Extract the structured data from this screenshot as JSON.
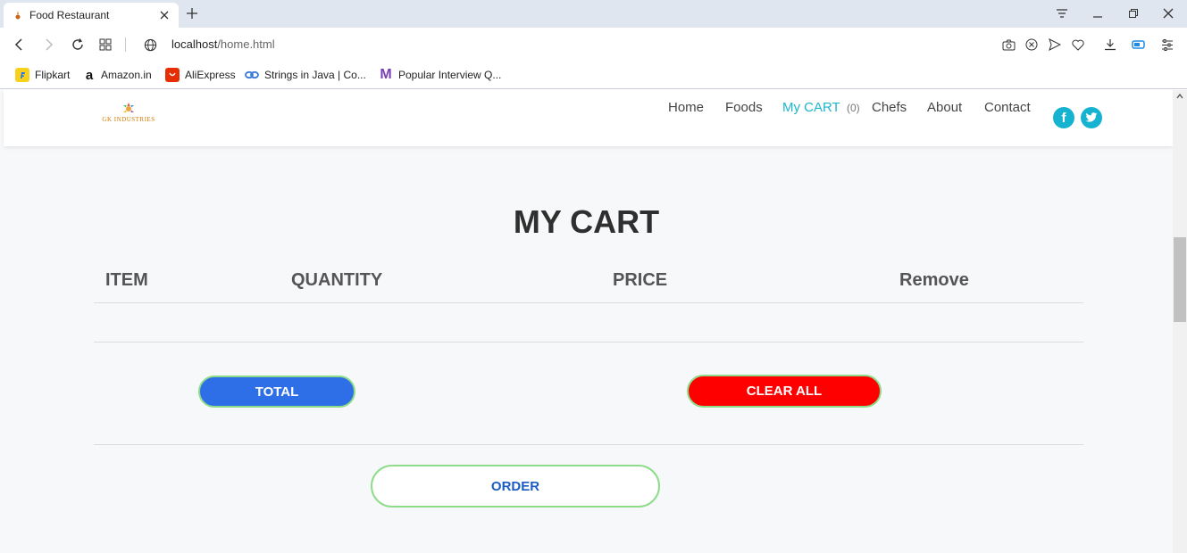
{
  "browser": {
    "tab_title": "Food Restaurant",
    "url_host": "localhost",
    "url_path": "/home.html",
    "bookmarks": [
      {
        "label": "Flipkart",
        "icon": "flipkart-icon"
      },
      {
        "label": "Amazon.in",
        "icon": "amazon-icon"
      },
      {
        "label": "AliExpress",
        "icon": "aliexpress-icon"
      },
      {
        "label": "Strings in Java | Co...",
        "icon": "link-icon"
      },
      {
        "label": "Popular Interview Q...",
        "icon": "m-logo-icon"
      }
    ],
    "amazon_glyph": "a",
    "m_glyph": "M"
  },
  "site": {
    "logo_text": "GK INDUSTRIES",
    "nav": {
      "home": "Home",
      "foods": "Foods",
      "my_cart": "My CART",
      "cart_count": "(0)",
      "chefs": "Chefs",
      "about": "About",
      "contact": "Contact"
    },
    "social": {
      "facebook": "f"
    }
  },
  "cart": {
    "title": "MY CART",
    "columns": {
      "item": "ITEM",
      "quantity": "QUANTITY",
      "price": "PRICE",
      "remove": "Remove"
    },
    "total_label": "TOTAL",
    "clear_label": "CLEAR ALL",
    "order_label": "ORDER"
  },
  "colors": {
    "accent": "#1bb6cc",
    "total_button": "#2e6ee6",
    "clear_button": "#ff0000",
    "button_border": "#8edc8a",
    "order_text": "#1b5cc4"
  }
}
